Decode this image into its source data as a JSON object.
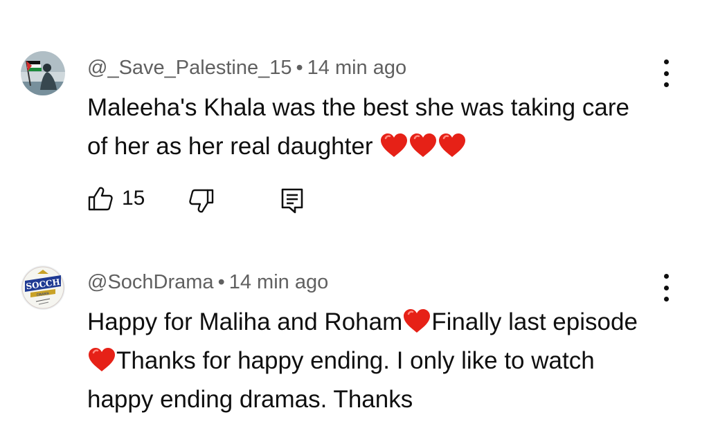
{
  "comments": [
    {
      "author": "@_Save_Palestine_15",
      "separator": "•",
      "time": "14 min ago",
      "text_parts": [
        "Maleeha's Khala was the best she was taking care of her as her real daughter "
      ],
      "like_count": "15"
    },
    {
      "author": "@SochDrama",
      "separator": "•",
      "time": "14 min ago",
      "text_parts": [
        "Happy for Maliha and Roham",
        "Finally last episode ",
        "Thanks for happy ending. I only like to watch happy ending dramas. Thanks"
      ],
      "avatar_text": [
        "SOCCH",
        "DRAMA"
      ]
    }
  ],
  "colors": {
    "heart": "#e62117",
    "meta": "#606060",
    "text": "#0f0f0f"
  },
  "icons": [
    "thumbs-up-icon",
    "thumbs-down-icon",
    "reply-icon",
    "more-vert-icon",
    "red-heart-emoji"
  ]
}
